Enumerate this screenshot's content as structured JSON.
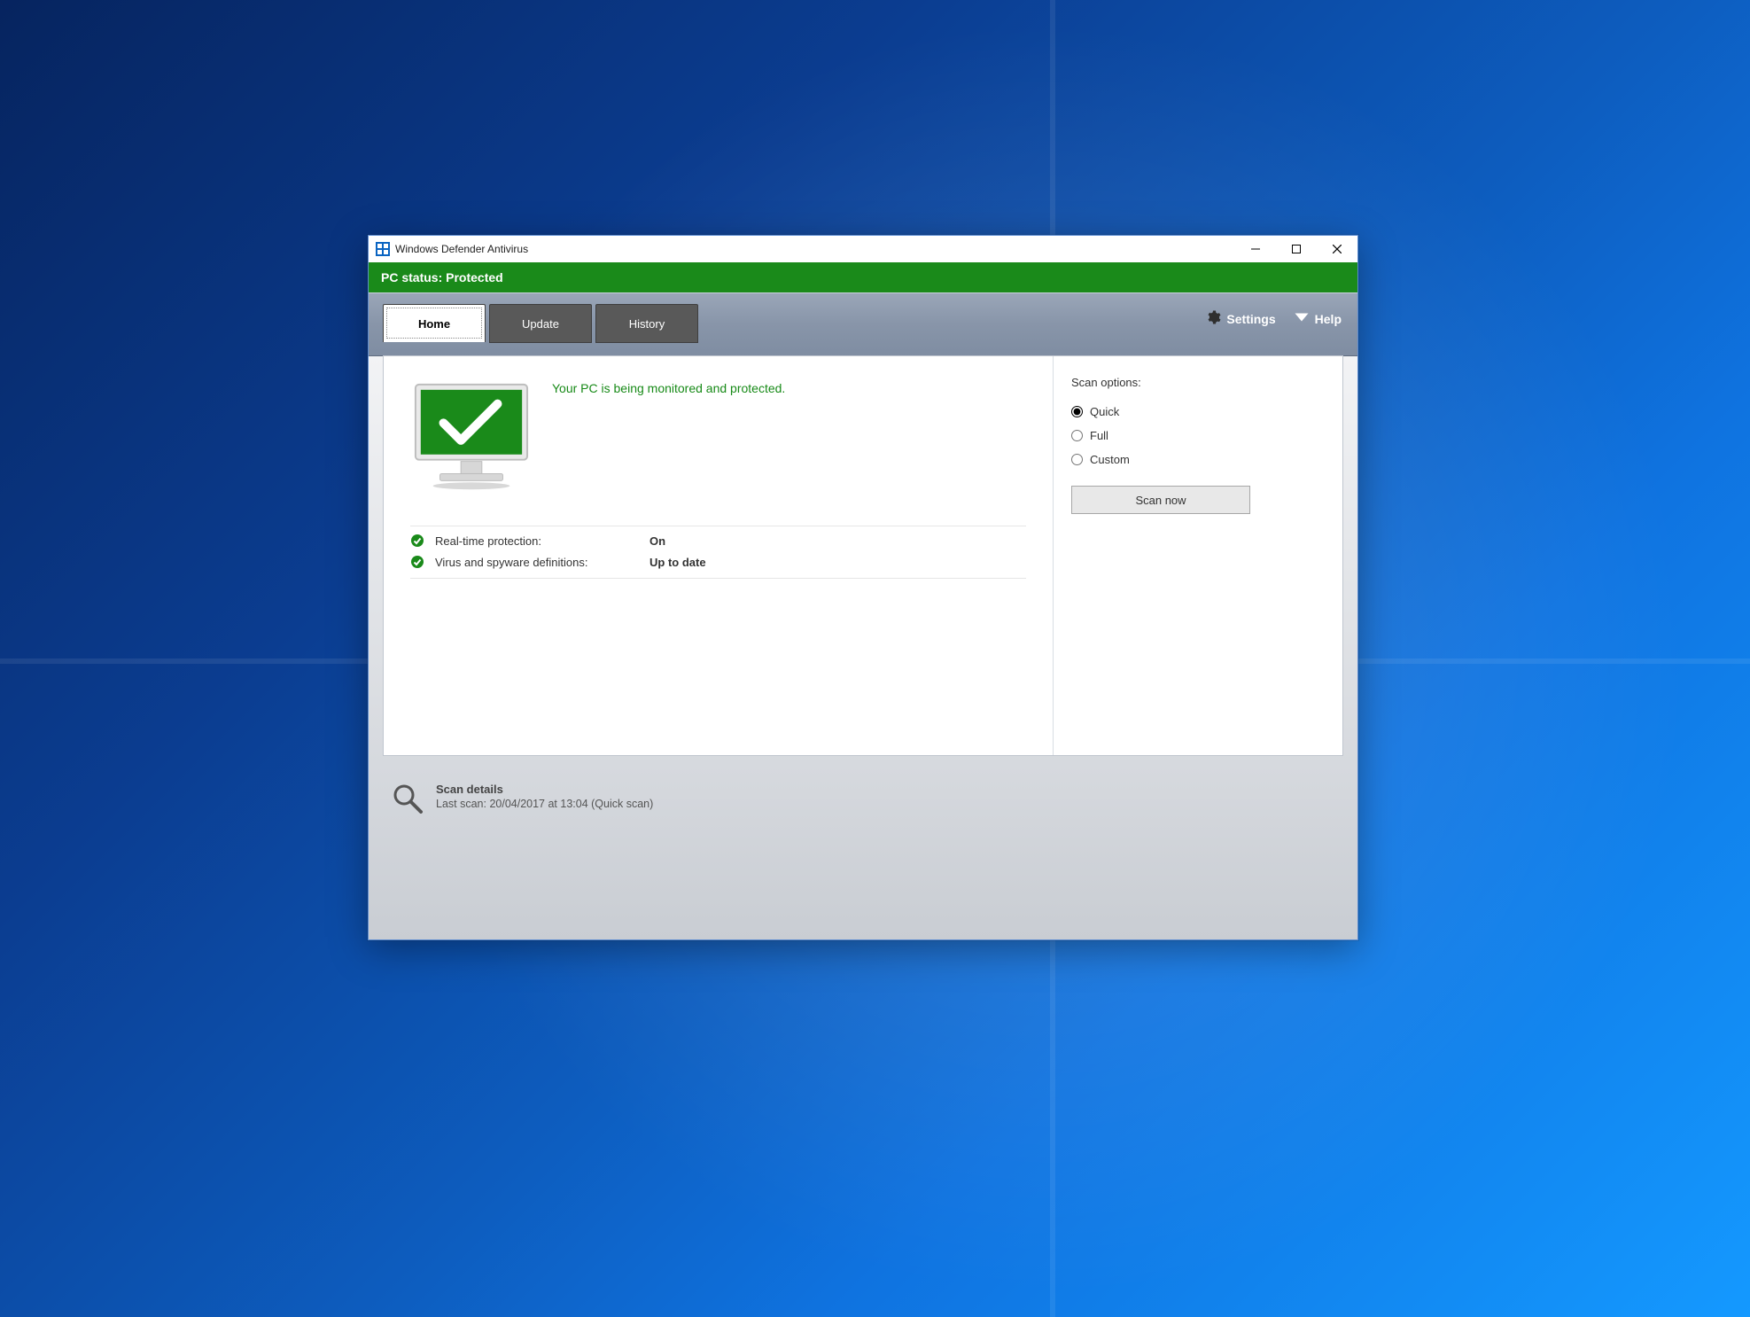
{
  "window": {
    "title": "Windows Defender Antivirus"
  },
  "status_strip": "PC status: Protected",
  "tabs": {
    "home": "Home",
    "update": "Update",
    "history": "History"
  },
  "toolbar": {
    "settings": "Settings",
    "help": "Help"
  },
  "main": {
    "hero_message": "Your PC is being monitored and protected.",
    "rows": {
      "rtp_label": "Real-time protection:",
      "rtp_value": "On",
      "def_label": "Virus and spyware definitions:",
      "def_value": "Up to date"
    }
  },
  "side": {
    "title": "Scan options:",
    "quick": "Quick",
    "full": "Full",
    "custom": "Custom",
    "scan_now": "Scan now"
  },
  "details": {
    "title": "Scan details",
    "last_scan": "Last scan:  20/04/2017 at 13:04 (Quick scan)"
  },
  "colors": {
    "status_green": "#1a8a1a",
    "accent_text_green": "#178a17"
  }
}
